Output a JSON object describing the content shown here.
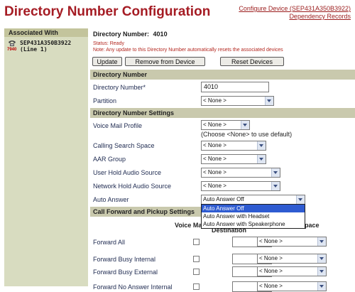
{
  "header": {
    "title": "Directory Number Configuration",
    "configure_link": "Configure Device (SEP431A350B3922)",
    "dependency_link": "Dependency Records"
  },
  "sidebar": {
    "heading": "Associated With",
    "device_model": "7940",
    "device_name": "SEP431A350B3922",
    "device_line": "(Line 1)"
  },
  "summary": {
    "label": "Directory Number:",
    "value": "4010",
    "status": "Status:  Ready",
    "note": "Note: Any update to this Directory Number automatically resets the associated devices"
  },
  "toolbar": {
    "update": "Update",
    "remove": "Remove from Device",
    "reset": "Reset Devices"
  },
  "dn_section": {
    "title": "Directory Number",
    "dn_label": "Directory Number*",
    "dn_value": "4010",
    "partition_label": "Partition",
    "partition_value": "< None >"
  },
  "settings": {
    "title": "Directory Number Settings",
    "voicemail_label": "Voice Mail Profile",
    "voicemail_value": "< None >",
    "voicemail_hint": "(Choose <None> to use default)",
    "css_label": "Calling Search Space",
    "css_value": "< None >",
    "aar_label": "AAR Group",
    "aar_value": "< None >",
    "userhold_label": "User Hold Audio Source",
    "userhold_value": "< None >",
    "nethold_label": "Network Hold Audio Source",
    "nethold_value": "< None >",
    "autoanswer_label": "Auto Answer",
    "autoanswer_value": "Auto Answer Off",
    "autoanswer_options": [
      "Auto Answer Off",
      "Auto Answer with Headset",
      "Auto Answer with Speakerphone"
    ]
  },
  "forward": {
    "title": "Call Forward and Pickup Settings",
    "col_voicemail": "Voice Mail",
    "col_destination": "Destination",
    "col_css": "Calling Search Space",
    "rows": [
      {
        "label": "Forward All",
        "css": "< None >"
      },
      {
        "label": "Forward Busy Internal",
        "css": "< None >"
      },
      {
        "label": "Forward Busy External",
        "css": "< None >"
      },
      {
        "label": "Forward No Answer Internal",
        "css": "< None >"
      }
    ]
  },
  "colors": {
    "title": "#a51c24",
    "section_bg": "#c9c9ad",
    "sidebar_bg": "#d8dcc0",
    "highlight": "#2e5bd1"
  }
}
